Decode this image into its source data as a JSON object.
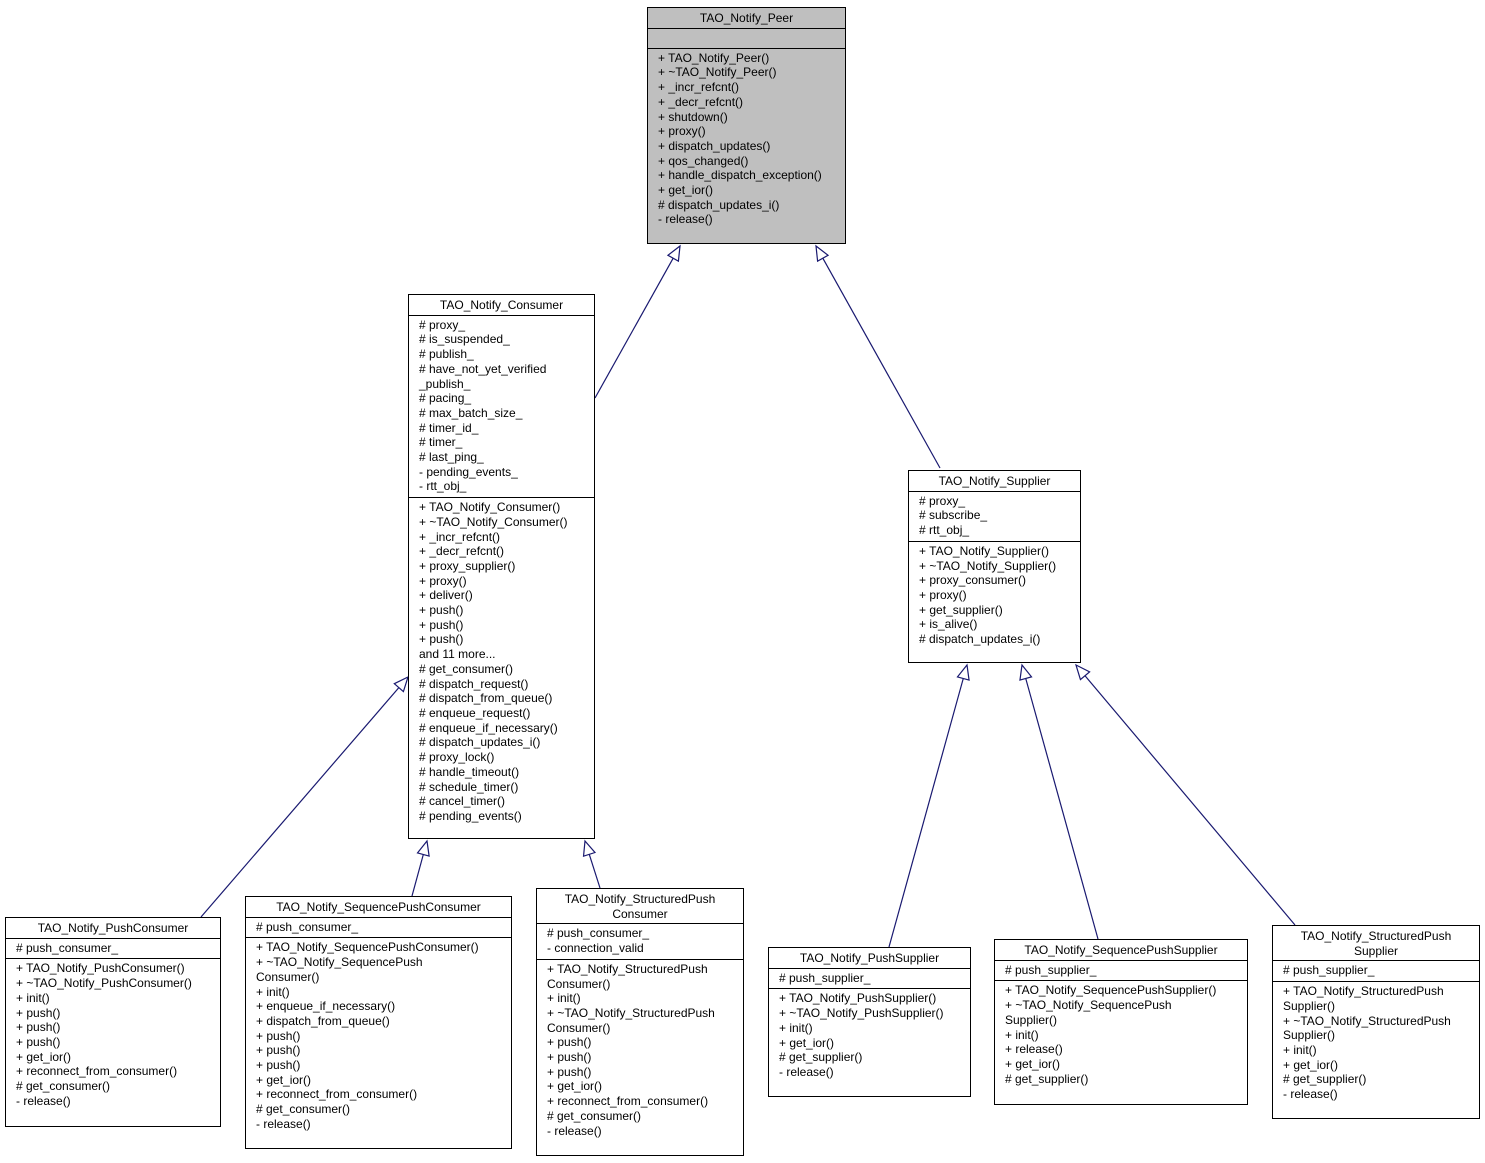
{
  "diagram": {
    "type": "class-inheritance",
    "edge_color": "#191970",
    "highlight_color": "#bfbfbf",
    "classes": {
      "peer": {
        "name": "TAO_Notify_Peer",
        "attributes": [],
        "methods": [
          "+ TAO_Notify_Peer()",
          "+ ~TAO_Notify_Peer()",
          "+ _incr_refcnt()",
          "+ _decr_refcnt()",
          "+ shutdown()",
          "+ proxy()",
          "+ dispatch_updates()",
          "+ qos_changed()",
          "+ handle_dispatch_exception()",
          "+ get_ior()",
          "# dispatch_updates_i()",
          "- release()"
        ]
      },
      "consumer": {
        "name": "TAO_Notify_Consumer",
        "attributes": [
          "# proxy_",
          "# is_suspended_",
          "# publish_",
          "# have_not_yet_verified",
          "_publish_",
          "# pacing_",
          "# max_batch_size_",
          "# timer_id_",
          "# timer_",
          "# last_ping_",
          "- pending_events_",
          "- rtt_obj_"
        ],
        "methods": [
          "+ TAO_Notify_Consumer()",
          "+ ~TAO_Notify_Consumer()",
          "+ _incr_refcnt()",
          "+ _decr_refcnt()",
          "+ proxy_supplier()",
          "+ proxy()",
          "+ deliver()",
          "+ push()",
          "+ push()",
          "+ push()",
          "and 11 more...",
          "# get_consumer()",
          "# dispatch_request()",
          "# dispatch_from_queue()",
          "# enqueue_request()",
          "# enqueue_if_necessary()",
          "# dispatch_updates_i()",
          "# proxy_lock()",
          "# handle_timeout()",
          "# schedule_timer()",
          "# cancel_timer()",
          "# pending_events()"
        ]
      },
      "supplier": {
        "name": "TAO_Notify_Supplier",
        "attributes": [
          "# proxy_",
          "# subscribe_",
          "# rtt_obj_"
        ],
        "methods": [
          "+ TAO_Notify_Supplier()",
          "+ ~TAO_Notify_Supplier()",
          "+ proxy_consumer()",
          "+ proxy()",
          "+ get_supplier()",
          "+ is_alive()",
          "# dispatch_updates_i()"
        ]
      },
      "push_consumer": {
        "name": "TAO_Notify_PushConsumer",
        "attributes": [
          "# push_consumer_"
        ],
        "methods": [
          "+ TAO_Notify_PushConsumer()",
          "+ ~TAO_Notify_PushConsumer()",
          "+ init()",
          "+ push()",
          "+ push()",
          "+ push()",
          "+ get_ior()",
          "+ reconnect_from_consumer()",
          "# get_consumer()",
          "- release()"
        ]
      },
      "seq_push_consumer": {
        "name": "TAO_Notify_SequencePushConsumer",
        "attributes": [
          "# push_consumer_"
        ],
        "methods": [
          "+ TAO_Notify_SequencePushConsumer()",
          "+ ~TAO_Notify_SequencePush",
          "Consumer()",
          "+ init()",
          "+ enqueue_if_necessary()",
          "+ dispatch_from_queue()",
          "+ push()",
          "+ push()",
          "+ push()",
          "+ get_ior()",
          "+ reconnect_from_consumer()",
          "# get_consumer()",
          "- release()"
        ]
      },
      "struct_push_consumer": {
        "name": "TAO_Notify_StructuredPush\nConsumer",
        "attributes": [
          "# push_consumer_",
          "- connection_valid"
        ],
        "methods": [
          "+ TAO_Notify_StructuredPush",
          "Consumer()",
          "+ init()",
          "+ ~TAO_Notify_StructuredPush",
          "Consumer()",
          "+ push()",
          "+ push()",
          "+ push()",
          "+ get_ior()",
          "+ reconnect_from_consumer()",
          "# get_consumer()",
          "- release()"
        ]
      },
      "push_supplier": {
        "name": "TAO_Notify_PushSupplier",
        "attributes": [
          "# push_supplier_"
        ],
        "methods": [
          "+ TAO_Notify_PushSupplier()",
          "+ ~TAO_Notify_PushSupplier()",
          "+ init()",
          "+ get_ior()",
          "# get_supplier()",
          "- release()"
        ]
      },
      "seq_push_supplier": {
        "name": "TAO_Notify_SequencePushSupplier",
        "attributes": [
          "# push_supplier_"
        ],
        "methods": [
          "+ TAO_Notify_SequencePushSupplier()",
          "+ ~TAO_Notify_SequencePush",
          "Supplier()",
          "+ init()",
          "+ release()",
          "+ get_ior()",
          "# get_supplier()"
        ]
      },
      "struct_push_supplier": {
        "name": "TAO_Notify_StructuredPush\nSupplier",
        "attributes": [
          "# push_supplier_"
        ],
        "methods": [
          "+ TAO_Notify_StructuredPush",
          "Supplier()",
          "+ ~TAO_Notify_StructuredPush",
          "Supplier()",
          "+ init()",
          "+ get_ior()",
          "# get_supplier()",
          "- release()"
        ]
      }
    },
    "edges": [
      {
        "from": "consumer",
        "to": "peer",
        "kind": "inherits"
      },
      {
        "from": "supplier",
        "to": "peer",
        "kind": "inherits"
      },
      {
        "from": "push_consumer",
        "to": "consumer",
        "kind": "inherits"
      },
      {
        "from": "seq_push_consumer",
        "to": "consumer",
        "kind": "inherits"
      },
      {
        "from": "struct_push_consumer",
        "to": "consumer",
        "kind": "inherits"
      },
      {
        "from": "push_supplier",
        "to": "supplier",
        "kind": "inherits"
      },
      {
        "from": "seq_push_supplier",
        "to": "supplier",
        "kind": "inherits"
      },
      {
        "from": "struct_push_supplier",
        "to": "supplier",
        "kind": "inherits"
      }
    ]
  }
}
